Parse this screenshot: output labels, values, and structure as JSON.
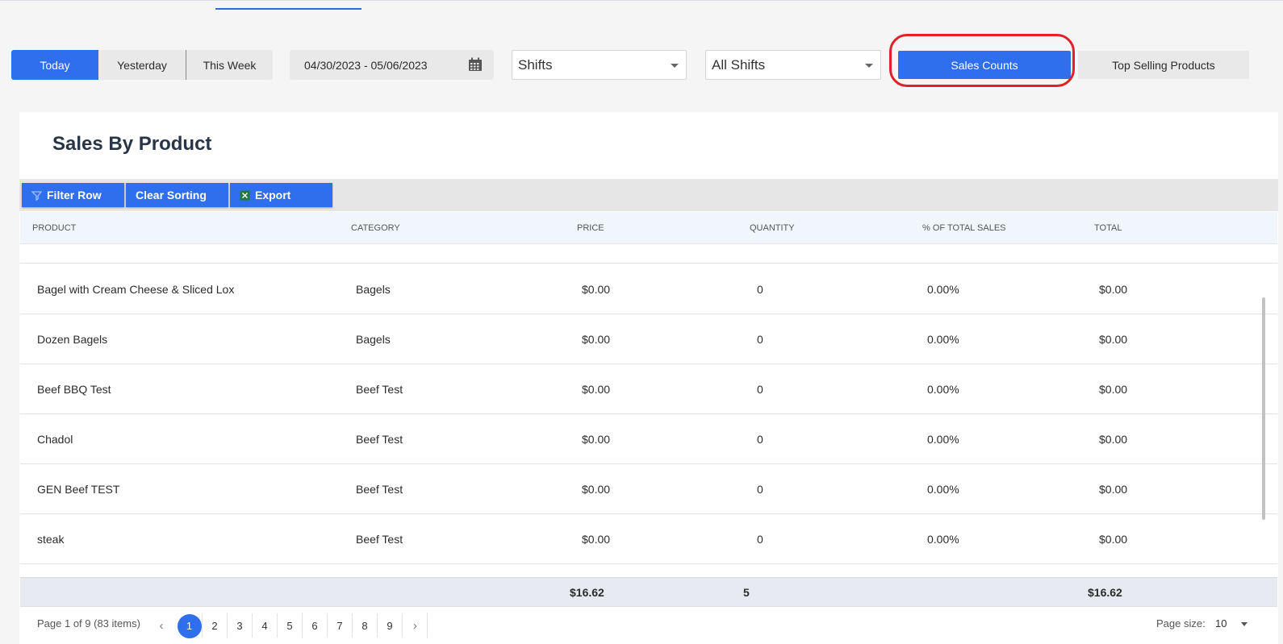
{
  "period_buttons": {
    "today": "Today",
    "yesterday": "Yesterday",
    "this_week": "This Week"
  },
  "date_range": {
    "value": "04/30/2023 - 05/06/2023"
  },
  "filters": {
    "shift_type": "Shifts",
    "shift_value": "All Shifts"
  },
  "report_buttons": {
    "sales_counts": "Sales Counts",
    "top_selling": "Top Selling Products"
  },
  "card": {
    "title": "Sales By Product"
  },
  "toolbar": {
    "filter_row": "Filter Row",
    "clear_sorting": "Clear Sorting",
    "export": "Export"
  },
  "grid": {
    "columns": [
      "PRODUCT",
      "CATEGORY",
      "PRICE",
      "QUANTITY",
      "% OF TOTAL SALES",
      "TOTAL"
    ],
    "rows": [
      {
        "product": "Bagel with Cream Cheese & Sliced Lox",
        "category": "Bagels",
        "price": "$0.00",
        "quantity": "0",
        "pct": "0.00%",
        "total": "$0.00"
      },
      {
        "product": "Dozen Bagels",
        "category": "Bagels",
        "price": "$0.00",
        "quantity": "0",
        "pct": "0.00%",
        "total": "$0.00"
      },
      {
        "product": "Beef BBQ Test",
        "category": "Beef Test",
        "price": "$0.00",
        "quantity": "0",
        "pct": "0.00%",
        "total": "$0.00"
      },
      {
        "product": "Chadol",
        "category": "Beef Test",
        "price": "$0.00",
        "quantity": "0",
        "pct": "0.00%",
        "total": "$0.00"
      },
      {
        "product": "GEN Beef TEST",
        "category": "Beef Test",
        "price": "$0.00",
        "quantity": "0",
        "pct": "0.00%",
        "total": "$0.00"
      },
      {
        "product": "steak",
        "category": "Beef Test",
        "price": "$0.00",
        "quantity": "0",
        "pct": "0.00%",
        "total": "$0.00"
      }
    ],
    "totals": {
      "price": "$16.62",
      "quantity": "5",
      "total": "$16.62"
    }
  },
  "pager": {
    "info": "Page 1 of 9 (83 items)",
    "prev": "‹",
    "next": "›",
    "pages": [
      "1",
      "2",
      "3",
      "4",
      "5",
      "6",
      "7",
      "8",
      "9"
    ],
    "page_size_label": "Page size:",
    "page_size_value": "10"
  },
  "colors": {
    "accent": "#2f6fee",
    "highlight": "#e0202a"
  }
}
